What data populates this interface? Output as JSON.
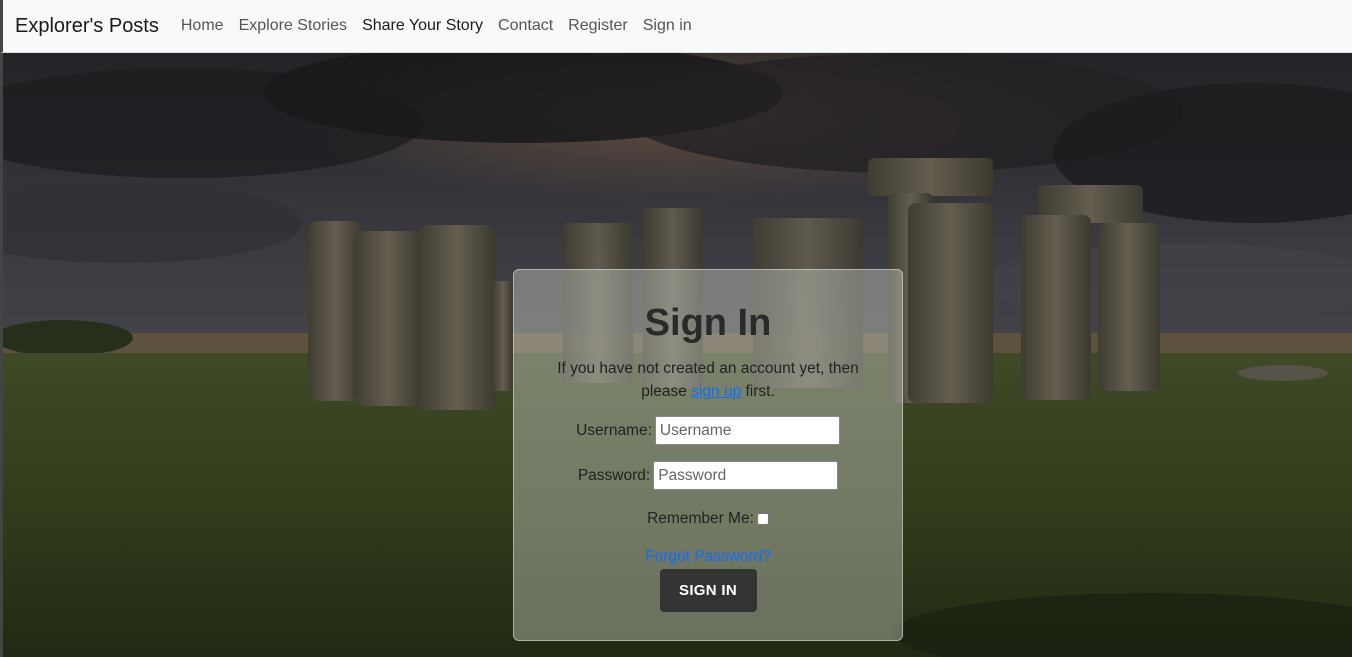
{
  "nav": {
    "brand": "Explorer's Posts",
    "links": [
      "Home",
      "Explore Stories",
      "Share Your Story",
      "Contact",
      "Register",
      "Sign in"
    ]
  },
  "signin": {
    "title": "Sign In",
    "intro_before": "If you have not created an account yet, then please ",
    "signup_link": "sign up",
    "intro_after": " first.",
    "username_label": "Username:",
    "username_placeholder": "Username",
    "password_label": "Password:",
    "password_placeholder": "Password",
    "remember_label": "Remember Me:",
    "remember_checked": false,
    "forgot_link": "Forgot Password?",
    "submit_label": "SIGN IN"
  },
  "colors": {
    "link": "#0d6efd",
    "button": "#333333",
    "navbar_bg": "#f8f9fa"
  },
  "background": {
    "image_icon": "stonehenge-landscape"
  }
}
